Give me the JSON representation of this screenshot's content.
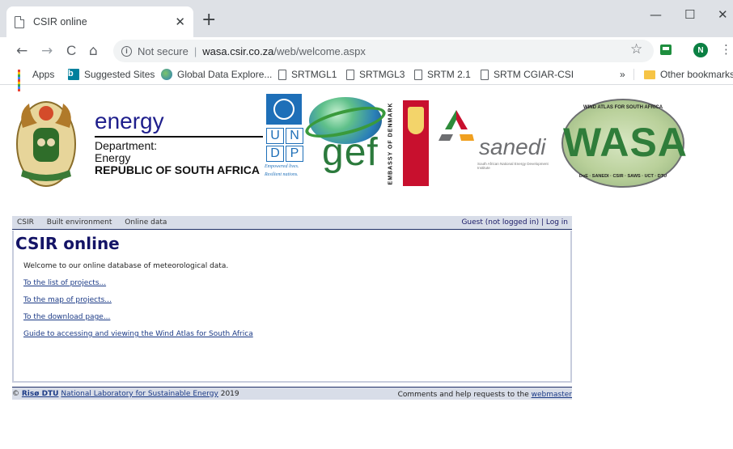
{
  "browser": {
    "tab_title": "CSIR online",
    "tab_close": "✕",
    "new_tab": "+",
    "window_controls": {
      "minimize": "—",
      "maximize": "☐",
      "close": "✕"
    },
    "nav": {
      "back": "←",
      "forward": "→",
      "reload": "C",
      "home": "⌂"
    },
    "address": {
      "security_label": "Not secure",
      "separator": "|",
      "host": "wasa.csir.co.za",
      "path": "/web/welcome.aspx"
    },
    "profile_initial": "N",
    "menu": "⋮",
    "star": "☆",
    "bookmarks": [
      {
        "label": "Apps",
        "icon": "apps-grid-icon"
      },
      {
        "label": "Suggested Sites",
        "icon": "bing-icon"
      },
      {
        "label": "Global Data Explore...",
        "icon": "globe-icon"
      },
      {
        "label": "SRTMGL1",
        "icon": "page-icon"
      },
      {
        "label": "SRTMGL3",
        "icon": "page-icon"
      },
      {
        "label": "SRTM 2.1",
        "icon": "page-icon"
      },
      {
        "label": "SRTM CGIAR-CSI",
        "icon": "page-icon"
      }
    ],
    "bookmarks_overflow": "»",
    "other_bookmarks": "Other bookmarks"
  },
  "logos": {
    "energy": {
      "word": "energy",
      "line1": "Department:",
      "line2": "Energy",
      "line3": "REPUBLIC OF SOUTH AFRICA"
    },
    "undp": {
      "letters": [
        "U",
        "N",
        "D",
        "P"
      ],
      "tagline1": "Empowered lives.",
      "tagline2": "Resilient nations."
    },
    "gef": "gef",
    "denmark": "EMBASSY OF DENMARK",
    "sanedi": {
      "word": "sanedi",
      "sub": "South African National Energy Development Institute"
    },
    "wasa": {
      "word": "WASA",
      "top": "WIND ATLAS FOR SOUTH AFRICA",
      "bottom": "DoE · SANEDI · CSIR · SAWS · UCT · DTU"
    }
  },
  "site": {
    "nav": [
      "CSIR",
      "Built environment",
      "Online data"
    ],
    "login_status": "Guest (not logged in) | Log in",
    "heading": "CSIR online",
    "welcome": "Welcome to our online database of meteorological data.",
    "links": [
      "To the list of projects...",
      "To the map of projects...",
      "To the download page...",
      "Guide to accessing and viewing the Wind Atlas for South Africa"
    ],
    "footer": {
      "copyright": "©",
      "riso": "Risø DTU",
      "lab": "National Laboratory for Sustainable Energy",
      "year": "2019",
      "comments": "Comments and help requests to the",
      "webmaster": "webmaster"
    }
  },
  "colors": {
    "brand_navy": "#141466",
    "link": "#1b3a86",
    "bar": "#d8dde8"
  }
}
